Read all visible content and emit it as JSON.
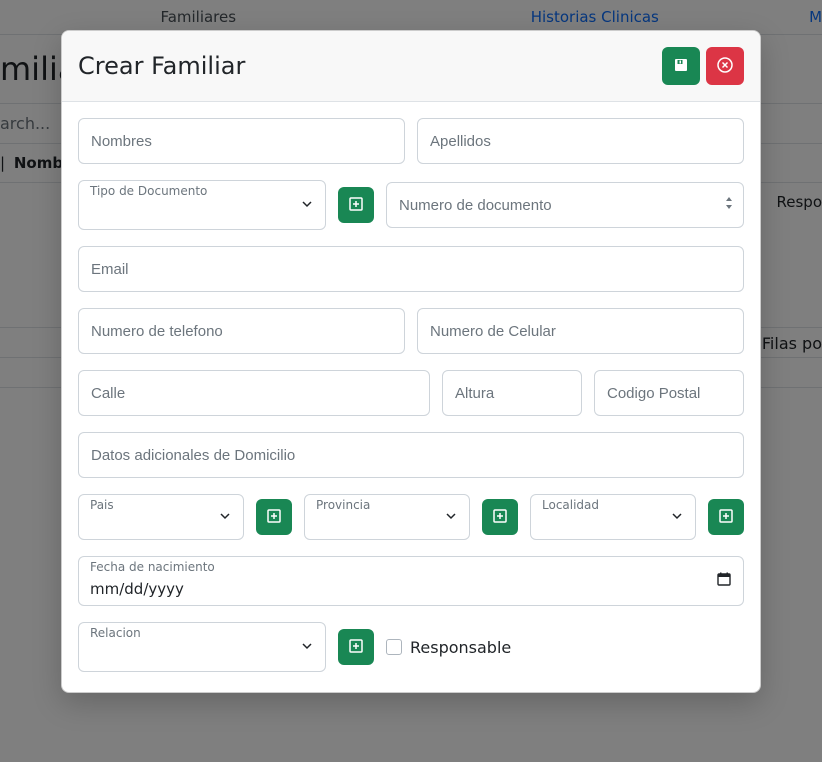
{
  "background": {
    "tabs": {
      "familiares": "Familiares",
      "historias": "Historias Clinicas",
      "more": "M"
    },
    "page_title_fragment": "miliar",
    "search_placeholder": "arch...",
    "col_divider": "|",
    "col_nombre": "Nombr",
    "col_respo": "Respo",
    "filas_por": "Filas po"
  },
  "modal": {
    "title": "Crear Familiar",
    "fields": {
      "nombres_ph": "Nombres",
      "apellidos_ph": "Apellidos",
      "tipo_doc_label": "Tipo de Documento",
      "num_doc_ph": "Numero de documento",
      "email_ph": "Email",
      "telefono_ph": "Numero de telefono",
      "celular_ph": "Numero de Celular",
      "calle_ph": "Calle",
      "altura_ph": "Altura",
      "cp_ph": "Codigo Postal",
      "datos_adic_ph": "Datos adicionales de Domicilio",
      "pais_label": "Pais",
      "provincia_label": "Provincia",
      "localidad_label": "Localidad",
      "fecha_label": "Fecha de nacimiento",
      "fecha_value": "mm/dd/yyyy",
      "relacion_label": "Relacion",
      "responsable_label": "Responsable"
    }
  }
}
